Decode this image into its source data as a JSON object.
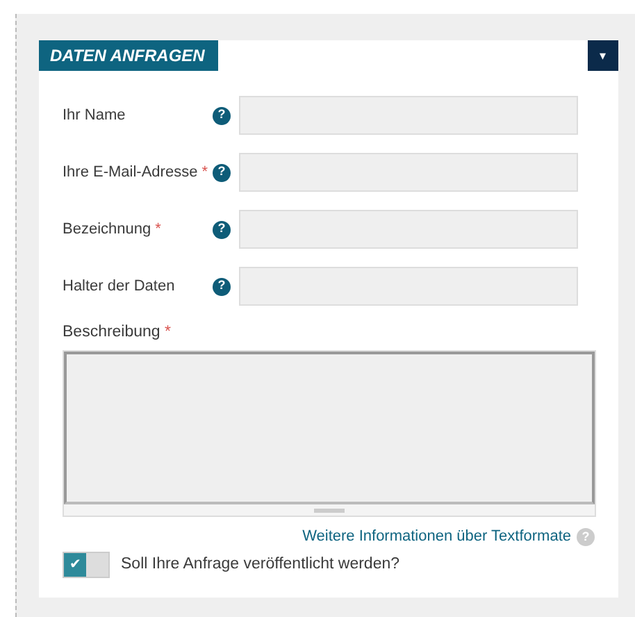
{
  "panel": {
    "title": "DATEN ANFRAGEN",
    "collapse_icon": "▾"
  },
  "fields": [
    {
      "label": "Ihr Name",
      "help": "?"
    },
    {
      "label": "Ihre E-Mail-Adresse",
      "asterisk": "*",
      "help": "?"
    },
    {
      "label": "Bezeichnung",
      "asterisk": "*",
      "help": "?"
    },
    {
      "label": "Halter der Daten",
      "help": "?"
    }
  ],
  "description": {
    "label": "Beschreibung",
    "asterisk": "*"
  },
  "format_link": {
    "text": "Weitere Informationen über Textformate",
    "help": "?"
  },
  "publish": {
    "label": "Soll Ihre Anfrage veröffentlicht werden?",
    "checked": true,
    "check_glyph": "✔"
  }
}
